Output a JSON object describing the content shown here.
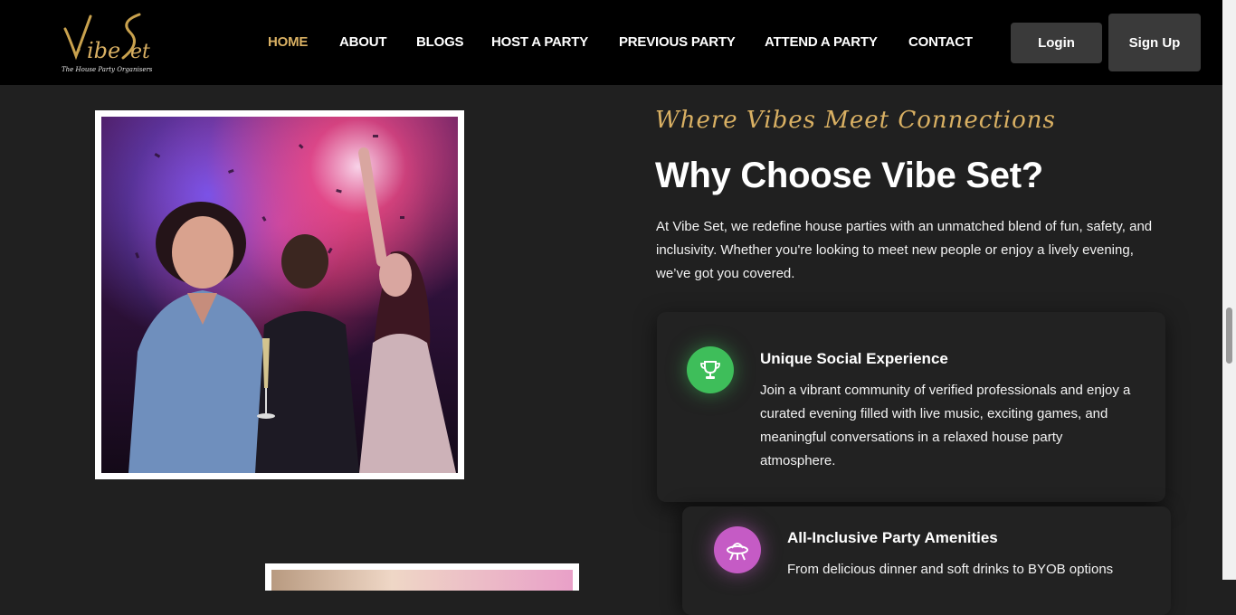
{
  "brand": {
    "logo_text": "VibeSet",
    "tagline": "The House Party Organisers"
  },
  "nav": {
    "items": [
      {
        "label": "HOME",
        "active": true
      },
      {
        "label": "ABOUT"
      },
      {
        "label": "BLOGS"
      },
      {
        "label": "HOST A PARTY"
      },
      {
        "label": "PREVIOUS PARTY"
      },
      {
        "label": "ATTEND A PARTY"
      },
      {
        "label": "CONTACT"
      }
    ],
    "login_label": "Login",
    "signup_label": "Sign Up"
  },
  "hero": {
    "script_heading": "Where Vibes Meet Connections",
    "title": "Why Choose Vibe Set?",
    "intro": "At Vibe Set, we redefine house parties with an unmatched blend of fun, safety, and inclusivity. Whether you're looking to meet new people or enjoy a lively evening, we’ve got you covered."
  },
  "features": [
    {
      "icon": "trophy-icon",
      "title": "Unique Social Experience",
      "description": "Join a vibrant community of verified professionals and enjoy a curated evening filled with live music, exciting games, and meaningful conversations in a relaxed house party atmosphere."
    },
    {
      "icon": "ufo-icon",
      "title": "All-Inclusive Party Amenities",
      "description": "From delicious dinner and soft drinks to BYOB options"
    }
  ],
  "colors": {
    "accent_gold": "#d9b063",
    "background": "#202020",
    "nav_background": "#000000",
    "icon_green": "#3ebe5a",
    "icon_purple": "#c55bc5"
  }
}
